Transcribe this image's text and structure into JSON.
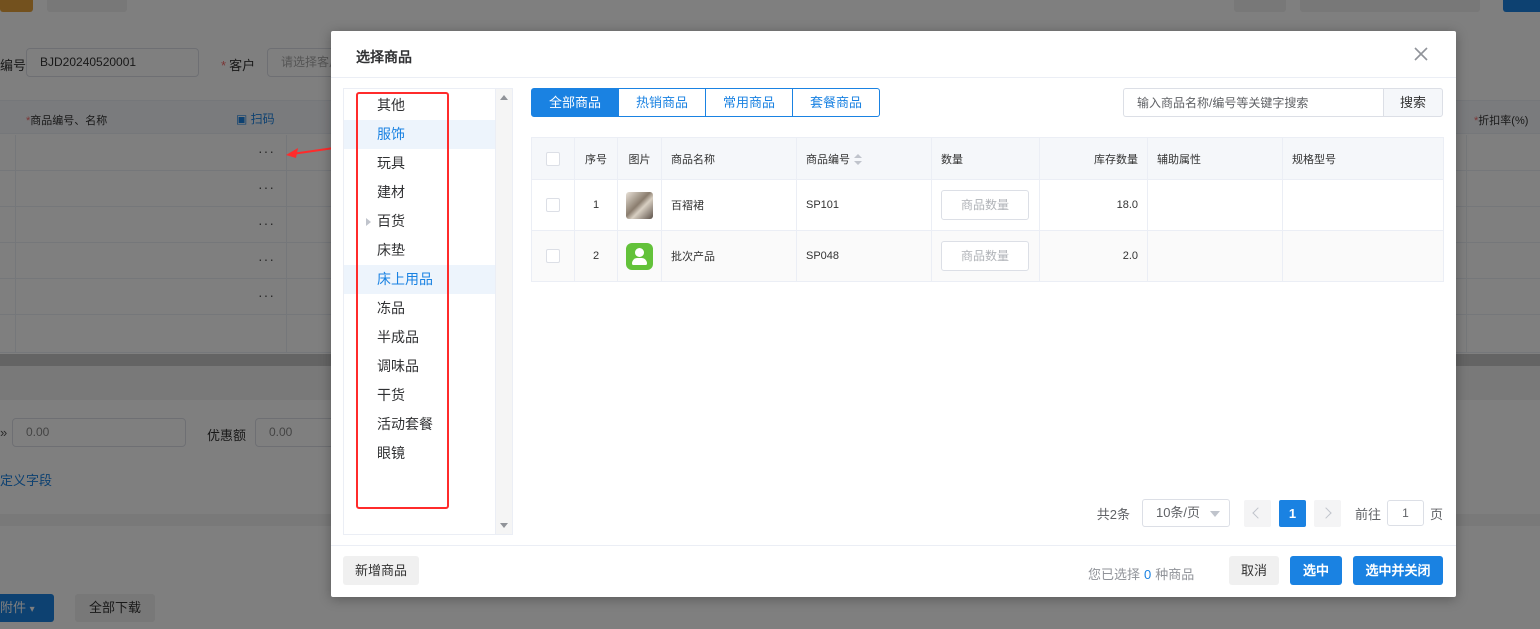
{
  "background": {
    "order_no_label": "编号",
    "order_no_value": "BJD20240520001",
    "customer_label": "客户",
    "customer_placeholder": "请选择客户",
    "col_goods": "商品编号、名称",
    "col_discount": "折扣率(%)",
    "scan_label": "扫码",
    "row_dots": "···",
    "amount_value_1": "0.00",
    "discount_amount_label": "优惠额",
    "amount_value_2": "0.00",
    "custom_field_link": "定义字段",
    "attachment_button": "附件",
    "download_all_button": "全部下载"
  },
  "dialog": {
    "title": "选择商品",
    "categories": [
      {
        "label": "其他",
        "active": false,
        "has_children": false
      },
      {
        "label": "服饰",
        "active": true,
        "has_children": false
      },
      {
        "label": "玩具",
        "active": false,
        "has_children": false
      },
      {
        "label": "建材",
        "active": false,
        "has_children": false
      },
      {
        "label": "百货",
        "active": false,
        "has_children": true
      },
      {
        "label": "床垫",
        "active": false,
        "has_children": false
      },
      {
        "label": "床上用品",
        "active": true,
        "has_children": false
      },
      {
        "label": "冻品",
        "active": false,
        "has_children": false
      },
      {
        "label": "半成品",
        "active": false,
        "has_children": false
      },
      {
        "label": "调味品",
        "active": false,
        "has_children": false
      },
      {
        "label": "干货",
        "active": false,
        "has_children": false
      },
      {
        "label": "活动套餐",
        "active": false,
        "has_children": false
      },
      {
        "label": "眼镜",
        "active": false,
        "has_children": false
      }
    ],
    "tabs": [
      {
        "label": "全部商品",
        "active": true
      },
      {
        "label": "热销商品",
        "active": false
      },
      {
        "label": "常用商品",
        "active": false
      },
      {
        "label": "套餐商品",
        "active": false
      }
    ],
    "search_placeholder": "输入商品名称/编号等关键字搜索",
    "search_button": "搜索",
    "table": {
      "headers": {
        "index": "序号",
        "image": "图片",
        "name": "商品名称",
        "code": "商品编号",
        "quantity": "数量",
        "stock": "库存数量",
        "aux_attr": "辅助属性",
        "spec": "规格型号"
      },
      "rows": [
        {
          "index": "1",
          "image": "dress-thumbnail",
          "name": "百褶裙",
          "code": "SP101",
          "quantity_placeholder": "商品数量",
          "stock": "18.0",
          "aux_attr": "",
          "spec": ""
        },
        {
          "index": "2",
          "image": "user-app-icon",
          "name": "批次产品",
          "code": "SP048",
          "quantity_placeholder": "商品数量",
          "stock": "2.0",
          "aux_attr": "",
          "spec": ""
        }
      ]
    },
    "pagination": {
      "total": "共2条",
      "page_size": "10条/页",
      "current_page": "1",
      "goto_label": "前往",
      "goto_value": "1",
      "page_suffix": "页"
    },
    "footer": {
      "new_goods_button": "新增商品",
      "selected_prefix": "您已选择",
      "selected_count": "0",
      "selected_suffix": "种商品",
      "cancel_button": "取消",
      "select_button": "选中",
      "select_close_button": "选中并关闭"
    }
  },
  "colors": {
    "primary": "#1a82e2",
    "annotation_red": "#ff2b2b",
    "required_star": "#f56c6c"
  }
}
